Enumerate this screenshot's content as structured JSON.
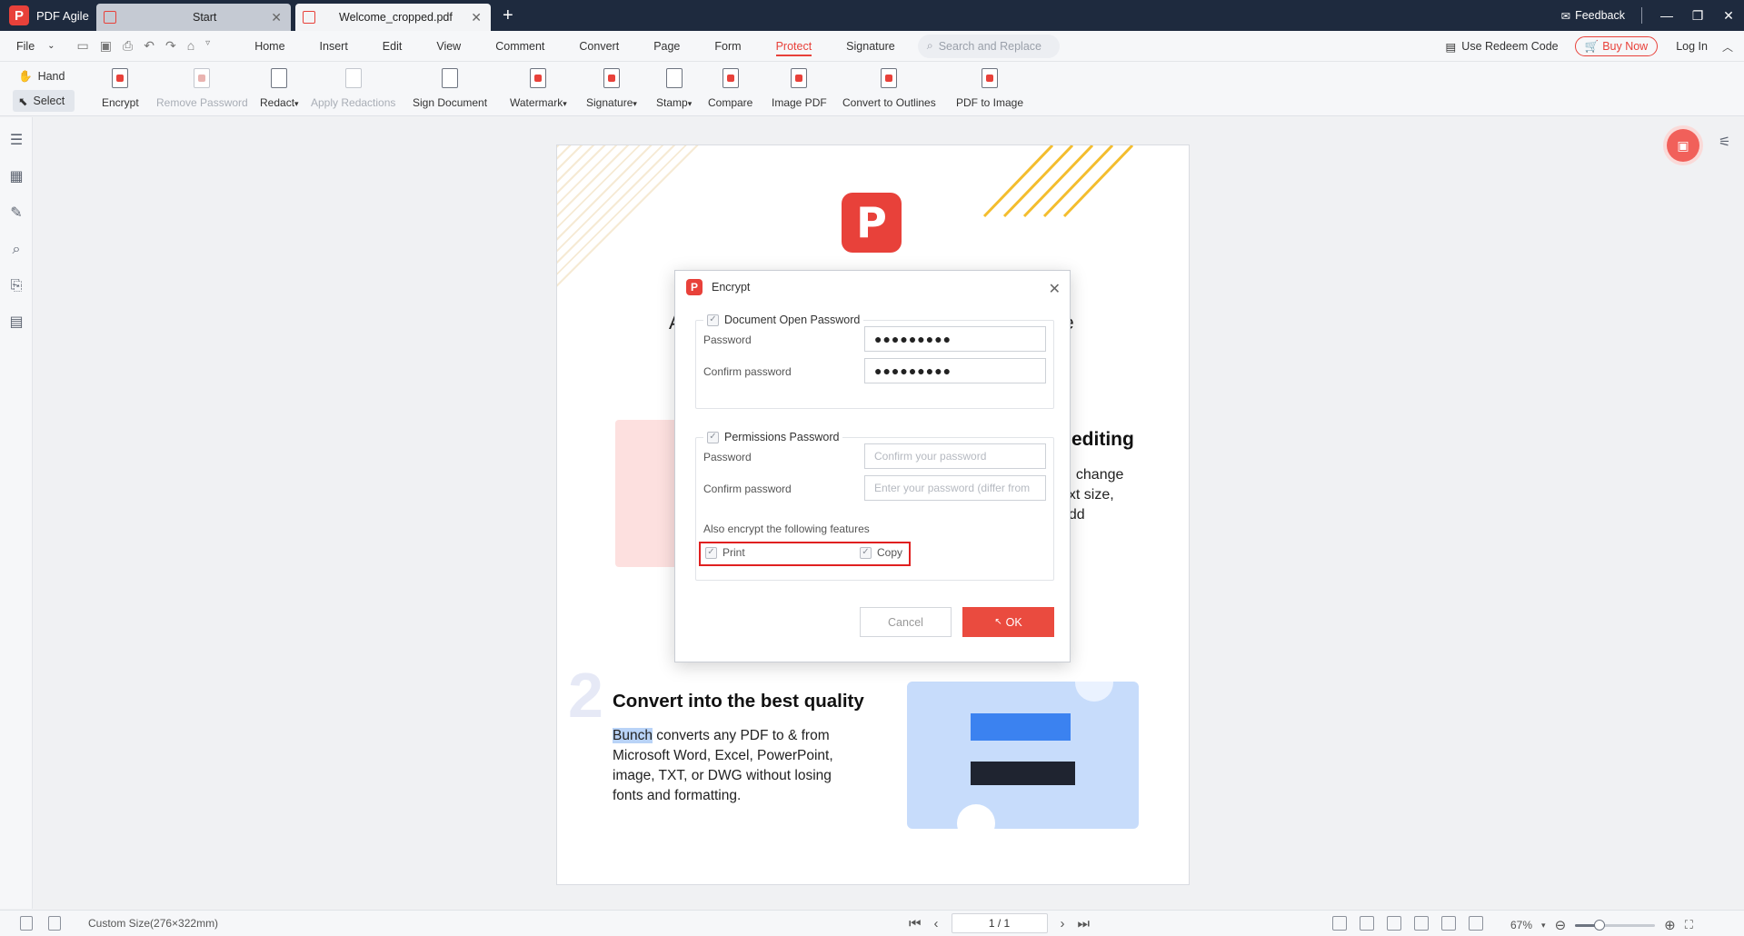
{
  "app": {
    "name": "PDF Agile",
    "logo_letter": "P"
  },
  "tabs": [
    {
      "label": "Start"
    },
    {
      "label": "Welcome_cropped.pdf"
    }
  ],
  "titlebar": {
    "feedback": "Feedback"
  },
  "menubar": {
    "file": "File",
    "items": [
      "Home",
      "Insert",
      "Edit",
      "View",
      "Comment",
      "Convert",
      "Page",
      "Form",
      "Protect",
      "Signature"
    ],
    "active": "Protect",
    "search_placeholder": "Search and Replace",
    "redeem": "Use Redeem Code",
    "buy_now": "Buy Now",
    "login": "Log In"
  },
  "ribbon": {
    "hand": "Hand",
    "select": "Select",
    "tools": [
      {
        "label": "Encrypt"
      },
      {
        "label": "Remove Password"
      },
      {
        "label": "Redact"
      },
      {
        "label": "Apply Redactions"
      },
      {
        "label": "Sign Document"
      },
      {
        "label": "Watermark"
      },
      {
        "label": "Signature"
      },
      {
        "label": "Stamp"
      },
      {
        "label": "Compare"
      },
      {
        "label": "Image PDF"
      },
      {
        "label": "Convert to Outlines"
      },
      {
        "label": "PDF to Image"
      }
    ]
  },
  "document": {
    "heading_fragment_left": "A",
    "heading_fragment_right": "e",
    "editing": "editing",
    "side_lines": [
      "s, change",
      "ext size,",
      "add"
    ],
    "section_number": "2",
    "section_title": "Convert into the best quality",
    "body_highlight": "Bunch",
    "body_rest": " converts any PDF to & from Microsoft Word, Excel, PowerPoint, image, TXT, or DWG without losing fonts and formatting."
  },
  "dialog": {
    "title": "Encrypt",
    "open_password": {
      "legend": "Document Open Password",
      "password_label": "Password",
      "password_value": "●●●●●●●●●",
      "confirm_label": "Confirm password",
      "confirm_value": "●●●●●●●●●"
    },
    "permissions": {
      "legend": "Permissions Password",
      "password_label": "Password",
      "password_placeholder": "Confirm your password",
      "confirm_label": "Confirm password",
      "confirm_placeholder": "Enter your password (differ from",
      "also_encrypt": "Also encrypt the following features",
      "print": "Print",
      "copy": "Copy"
    },
    "cancel": "Cancel",
    "ok": "OK"
  },
  "statusbar": {
    "page_size": "Custom Size(276×322mm)",
    "page_indicator": "1 / 1",
    "zoom": "67%",
    "zoom_fraction": 0.3
  },
  "colors": {
    "accent": "#e8413a",
    "titlebar": "#1e2a3e"
  }
}
